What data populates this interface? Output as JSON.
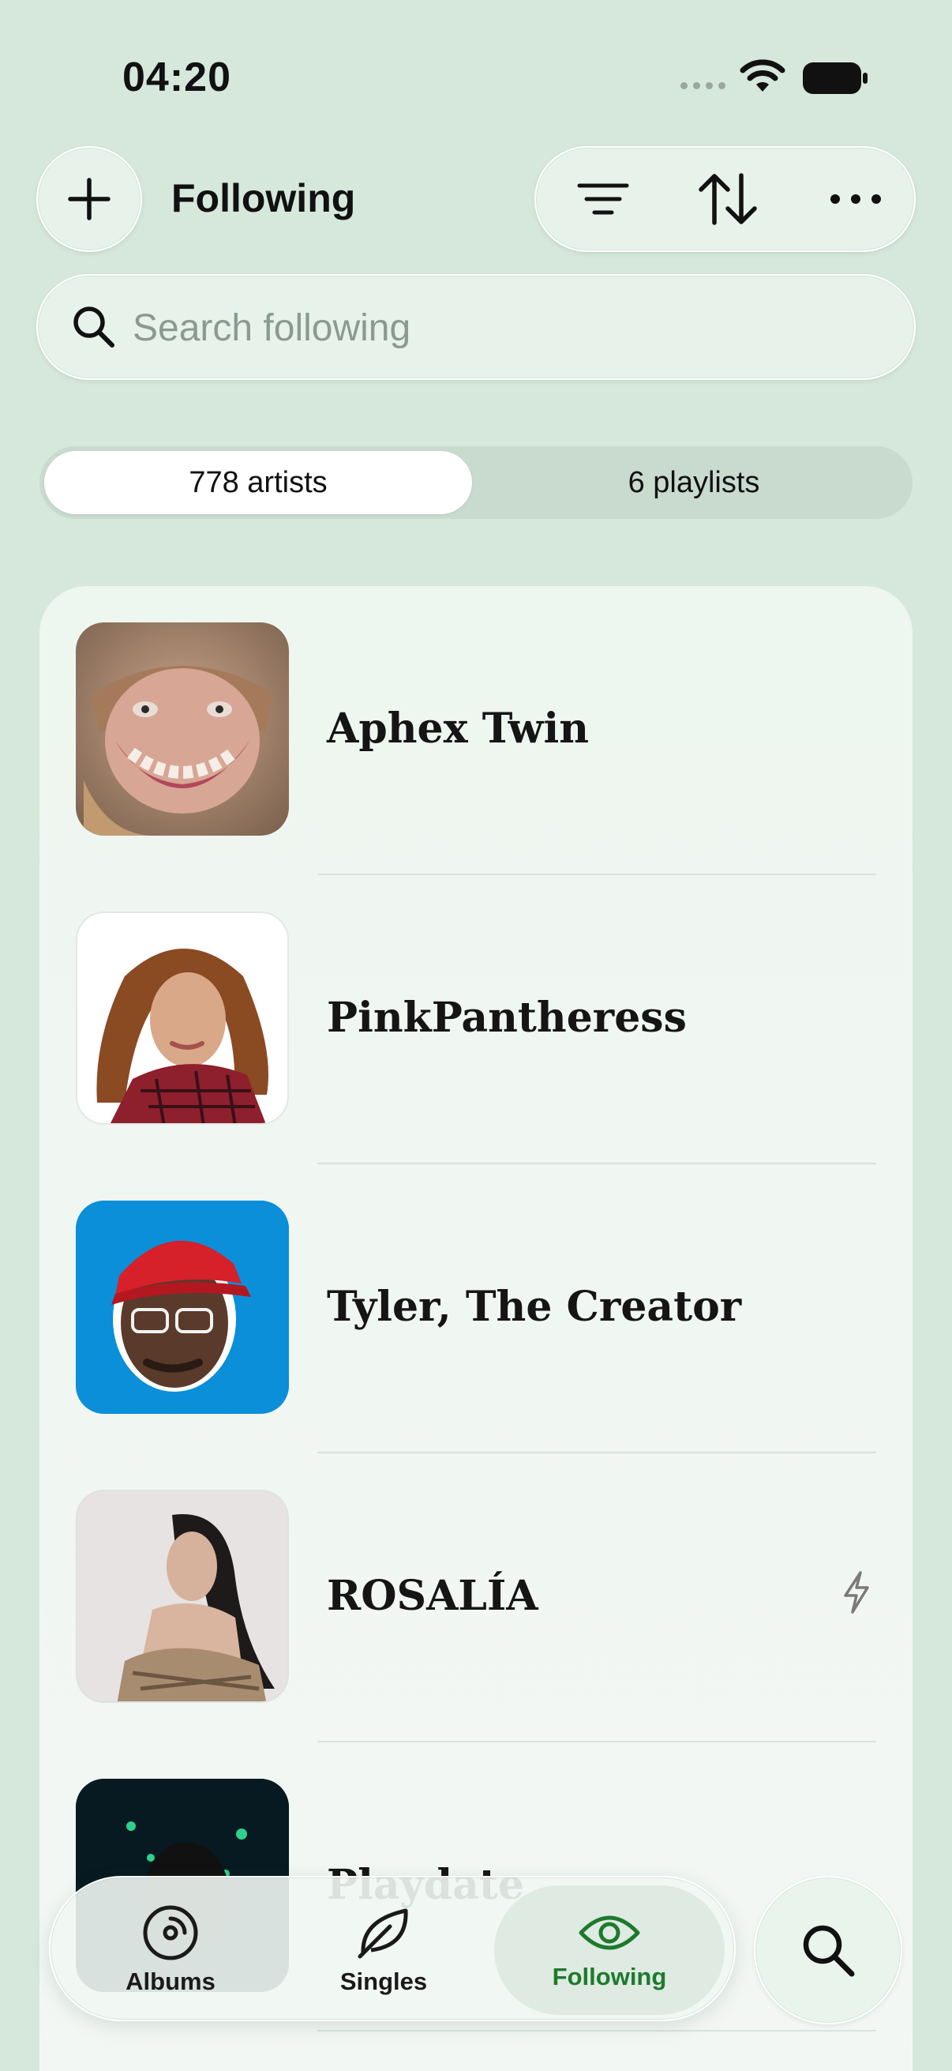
{
  "status_bar": {
    "time": "04:20"
  },
  "header": {
    "title": "Following"
  },
  "search": {
    "placeholder": "Search following",
    "value": ""
  },
  "segments": {
    "artists_label": "778 artists",
    "playlists_label": "6 playlists",
    "selected": "artists"
  },
  "artists": [
    {
      "name": "Aphex Twin"
    },
    {
      "name": "PinkPantheress"
    },
    {
      "name": "Tyler, The Creator"
    },
    {
      "name": "ROSALÍA"
    },
    {
      "name": "Playdate"
    }
  ],
  "tab_bar": {
    "albums_label": "Albums",
    "singles_label": "Singles",
    "following_label": "Following",
    "selected": "following"
  },
  "colors": {
    "accent": "#1d7a2d",
    "background": "#d6e8db",
    "card": "#eef6f0"
  },
  "icons": [
    "plus-icon",
    "filter-icon",
    "sort-icon",
    "more-icon",
    "search-icon",
    "bolt-icon",
    "vinyl-icon",
    "leaf-icon",
    "eye-icon",
    "wifi-icon",
    "battery-icon"
  ]
}
